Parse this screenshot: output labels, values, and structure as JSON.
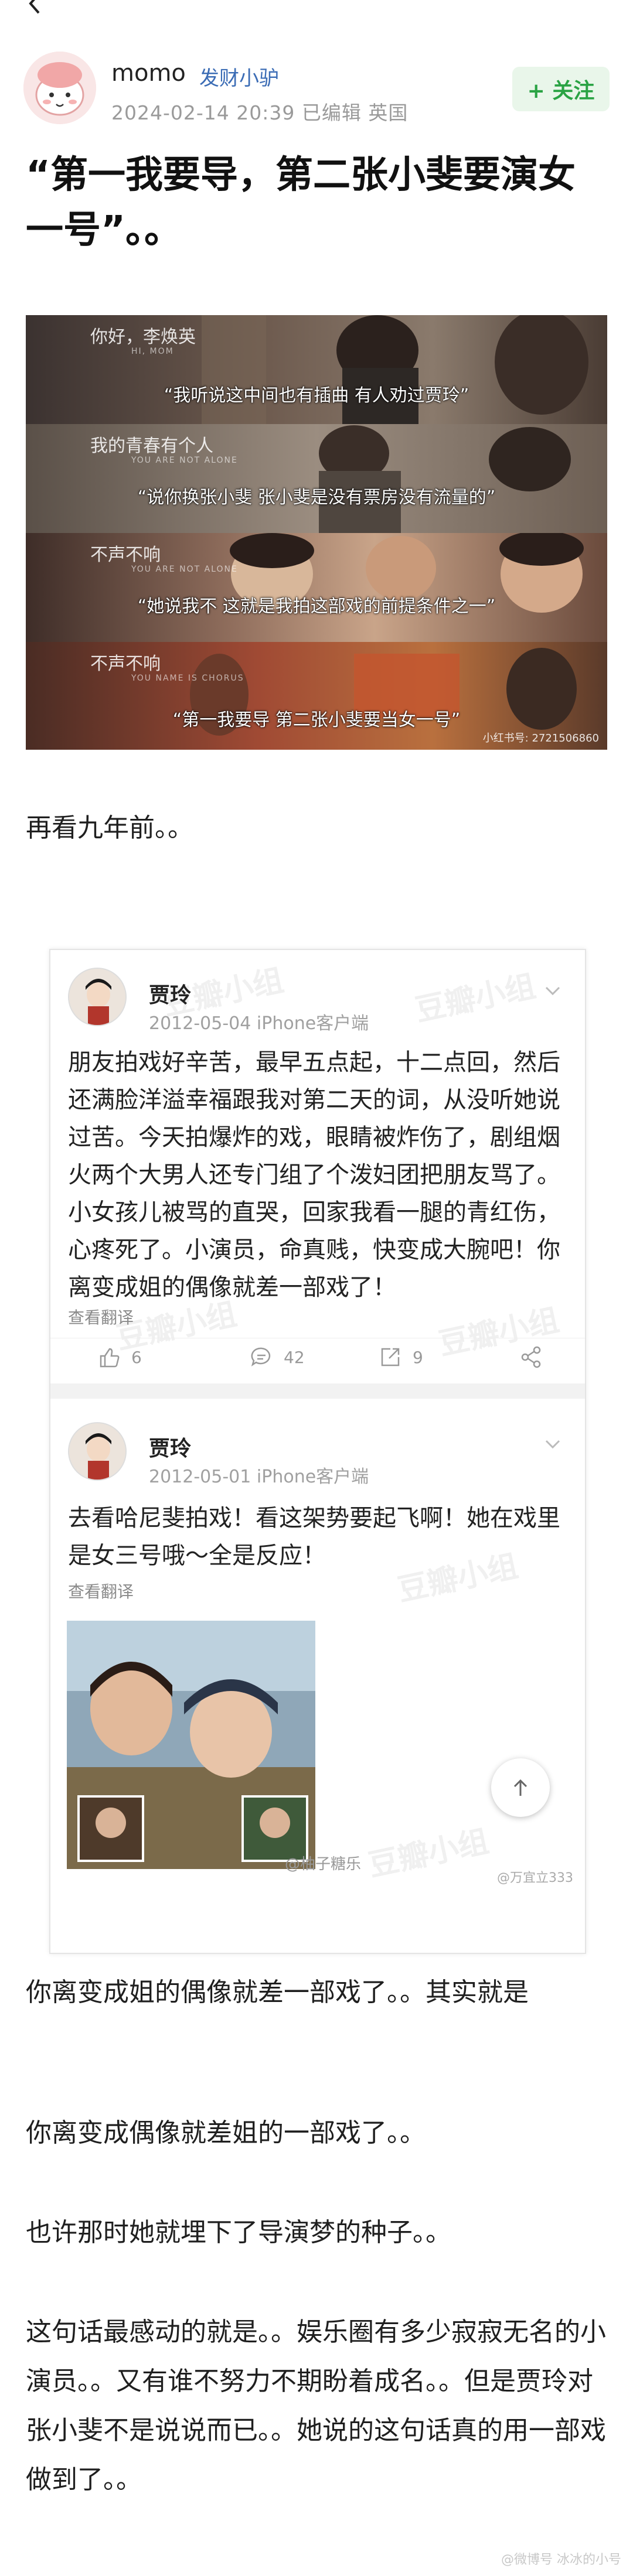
{
  "nav": {
    "back_icon": "chevron-left-icon"
  },
  "author": {
    "name": "momo",
    "group": "发财小驴",
    "date": "2024-02-14 20:39",
    "edited": "已编辑",
    "location": "英国",
    "follow_label": "+ 关注"
  },
  "post": {
    "title": "“第一我要导，第二张小斐要演女一号”。。",
    "banner": {
      "logos": [
        "你好，李焕英",
        "我的青春有个人",
        "不声不响",
        "不声不响"
      ],
      "logo_subs": [
        "HI, MOM",
        "YOU ARE NOT ALONE",
        "YOU ARE NOT ALONE",
        "YOU NAME IS CHORUS"
      ],
      "captions": [
        "“我听说这中间也有插曲 有人劝过贾玲”",
        "“说你换张小斐 张小斐是没有票房没有流量的”",
        "“她说我不 这就是我拍这部戏的前提条件之一”",
        "“第一我要导 第二张小斐要当女一号”"
      ],
      "watermark": "小红书号: 2721506860"
    },
    "para1": "再看九年前。。",
    "weibo": {
      "watermark": "豆瓣小组",
      "posts": [
        {
          "name": "贾玲",
          "date": "2012-05-04",
          "client": "iPhone客户端",
          "text": "朋友拍戏好辛苦，最早五点起，十二点回，然后还满脸洋溢幸福跟我对第二天的词，从没听她说过苦。今天拍爆炸的戏，眼睛被炸伤了，剧组烟火两个大男人还专门组了个泼妇团把朋友骂了。小女孩儿被骂的直哭，回家我看一腿的青红伤，心疼死了。小演员，命真贱，快变成大腕吧！你离变成姐的偶像就差一部戏了！",
          "translate": "查看翻译",
          "likes": "6",
          "comments": "42",
          "shares": "9"
        },
        {
          "name": "贾玲",
          "date": "2012-05-01",
          "client": "iPhone客户端",
          "text": "去看哈尼斐拍戏！看这架势要起飞啊！她在戏里是女三号哦～全是反应！",
          "translate": "查看翻译"
        }
      ],
      "photo_wm": "@柚子糖乐",
      "photo_wm2": "@万宜立333"
    },
    "para2": "你离变成姐的偶像就差一部戏了。。其实就是",
    "para3": "你离变成偶像就差姐的一部戏了。。",
    "para4": "也许那时她就埋下了导演梦的种子。。",
    "para5": "这句话最感动的就是。。娱乐圈有多少寂寂无名的小演员。。又有谁不努力不期盼着成名。。但是贾玲对张小斐不是说说而已。。她说的这句话真的用一部戏做到了。。",
    "bottom_watermark": "@微博号 冰冰的小号"
  },
  "colors": {
    "follow_bg": "#e9f6ea",
    "follow_text": "#2aa344",
    "group_link": "#3b6cb5"
  }
}
